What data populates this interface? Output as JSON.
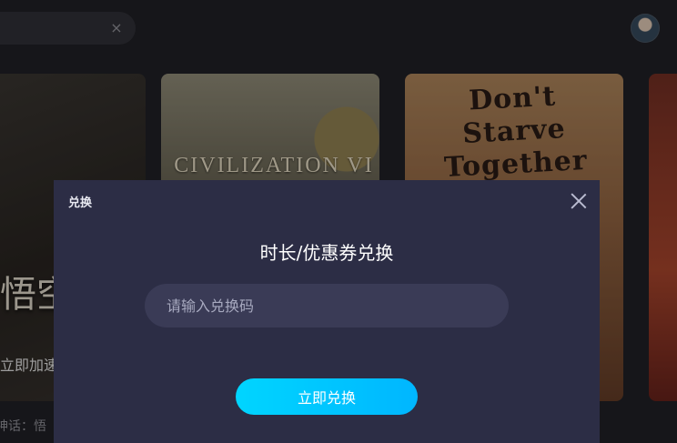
{
  "header": {
    "search": {
      "value": "",
      "clear_icon": "×"
    },
    "avatar": {
      "icon": "user-avatar"
    }
  },
  "games": [
    {
      "title": "悟空",
      "action_label": "立即加速",
      "name_label": "神话：悟"
    },
    {
      "title": "CIVILIZATION VI"
    },
    {
      "title": "Don't Starve Together"
    }
  ],
  "modal": {
    "title": "兑换",
    "heading": "时长/优惠券兑换",
    "input": {
      "placeholder": "请输入兑换码",
      "value": ""
    },
    "button_label": "立即兑换",
    "close_icon": "close-icon",
    "colors": {
      "accent": "#00c8ff",
      "modal_bg": "#2c2d45",
      "input_bg": "#3a3b56"
    }
  }
}
